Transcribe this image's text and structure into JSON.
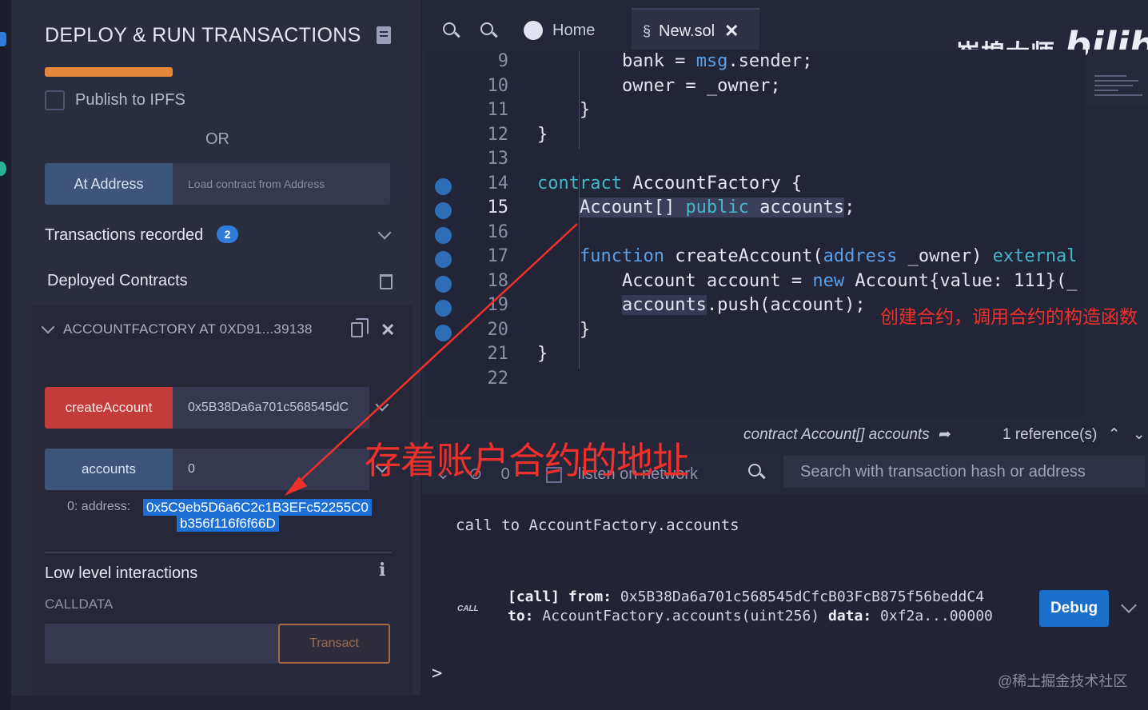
{
  "colors": {
    "accent_blue": "#3c5578",
    "danger_red": "#c43b3b",
    "orange": "#e3873a",
    "annotation_red": "#f0302a",
    "debug_blue": "#1b6fc8"
  },
  "left_panel": {
    "title": "DEPLOY & RUN TRANSACTIONS",
    "publish_label": "Publish to IPFS",
    "or_label": "OR",
    "at_address_label": "At Address",
    "at_address_placeholder": "Load contract from Address",
    "transactions_recorded_label": "Transactions recorded",
    "transactions_count": "2",
    "deployed_contracts_label": "Deployed Contracts",
    "contract_header": "ACCOUNTFACTORY AT 0XD91...39138",
    "create_account_label": "createAccount",
    "create_account_value": "0x5B38Da6a701c568545dC",
    "accounts_label": "accounts",
    "accounts_value": "0",
    "result_prefix": "0:  address:",
    "result_address_line1": "0x5C9eb5D6a6C2c1B3EFc52255C0",
    "result_address_line2": "b356f116f6f66D",
    "low_level_label": "Low level interactions",
    "calldata_label": "CALLDATA",
    "transact_label": "Transact"
  },
  "tabs": {
    "home": "Home",
    "active_file": "New.sol"
  },
  "branding": {
    "author": "崔棉大师",
    "site": "bilibili"
  },
  "editor": {
    "lines": [
      {
        "n": "9",
        "text": "        bank = msg.sender;"
      },
      {
        "n": "10",
        "text": "        owner = _owner;"
      },
      {
        "n": "11",
        "text": "    }"
      },
      {
        "n": "12",
        "text": "}"
      },
      {
        "n": "13",
        "text": ""
      },
      {
        "n": "14",
        "text": "contract AccountFactory {"
      },
      {
        "n": "15",
        "text": "    Account[] public accounts;"
      },
      {
        "n": "16",
        "text": ""
      },
      {
        "n": "17",
        "text": "    function createAccount(address _owner) external"
      },
      {
        "n": "18",
        "text": "        Account account = new Account{value: 111}(_"
      },
      {
        "n": "19",
        "text": "        accounts.push(account);"
      },
      {
        "n": "20",
        "text": "    }"
      },
      {
        "n": "21",
        "text": "}"
      },
      {
        "n": "22",
        "text": ""
      }
    ]
  },
  "reference_bar": {
    "declaration": "contract Account[] accounts",
    "count": "1 reference(s)"
  },
  "terminal": {
    "counter": "0",
    "listen_label": "listen on network",
    "search_placeholder": "Search with transaction hash or address",
    "call_summary": "call to AccountFactory.accounts",
    "call_tag": "CALL",
    "call_line1_key": "[call]",
    "call_line1_from_key": "from:",
    "call_line1_from_val": "0x5B38Da6a701c568545dCfcB03FcB875f56beddC4",
    "call_line2_to_key": "to:",
    "call_line2_to_val": "AccountFactory.accounts(uint256)",
    "call_line2_data_key": "data:",
    "call_line2_data_val": "0xf2a...00000",
    "debug_label": "Debug",
    "prompt": ">",
    "watermark": "@稀土掘金技术社区"
  },
  "annotations": {
    "big": "存着账户合约的地址",
    "small": "创建合约，调用合约的构造函数"
  }
}
